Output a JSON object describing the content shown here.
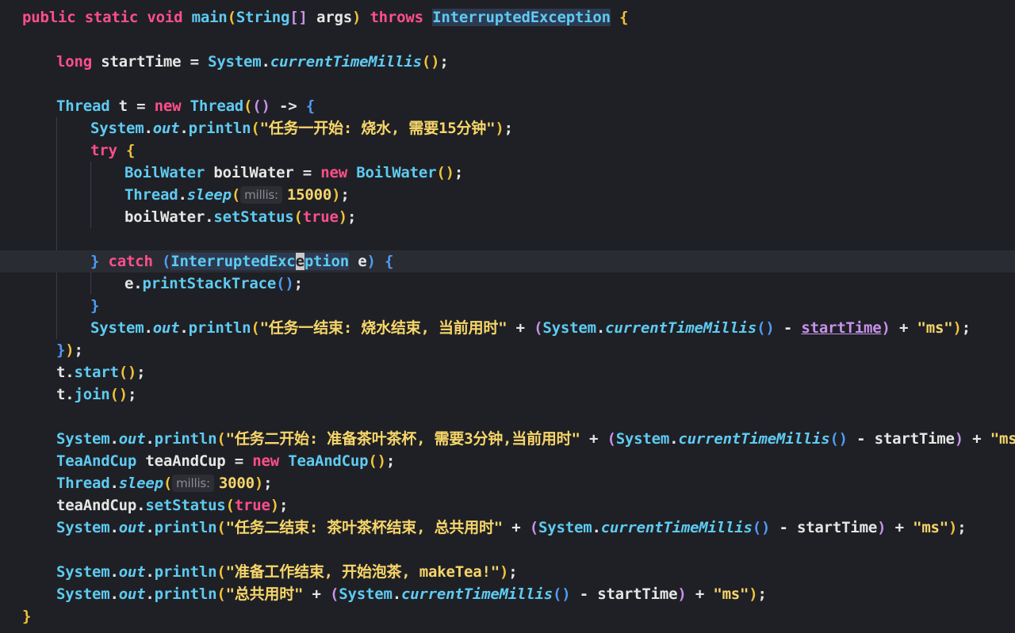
{
  "editor": {
    "language": "java",
    "current_line": 11,
    "lines": [
      {
        "indent": 0,
        "tokens": [
          {
            "t": "public",
            "c": "kw"
          },
          {
            "t": " "
          },
          {
            "t": "static",
            "c": "kw"
          },
          {
            "t": " "
          },
          {
            "t": "void",
            "c": "kw"
          },
          {
            "t": " "
          },
          {
            "t": "main",
            "c": "fn"
          },
          {
            "t": "(",
            "c": "p1"
          },
          {
            "t": "String",
            "c": "ty"
          },
          {
            "t": "[]",
            "c": "p2"
          },
          {
            "t": " args",
            "c": "id"
          },
          {
            "t": ")",
            "c": "p1"
          },
          {
            "t": " "
          },
          {
            "t": "throws",
            "c": "kw"
          },
          {
            "t": " "
          },
          {
            "t": "InterruptedException",
            "c": "hl"
          },
          {
            "t": " "
          },
          {
            "t": "{",
            "c": "br"
          }
        ]
      },
      {
        "indent": 0,
        "tokens": []
      },
      {
        "indent": 1,
        "tokens": [
          {
            "t": "long",
            "c": "kw"
          },
          {
            "t": " startTime = ",
            "c": "id"
          },
          {
            "t": "System",
            "c": "ty"
          },
          {
            "t": ".",
            "c": "op"
          },
          {
            "t": "currentTimeMillis",
            "c": "sf"
          },
          {
            "t": "()",
            "c": "p1"
          },
          {
            "t": ";",
            "c": "op"
          }
        ]
      },
      {
        "indent": 0,
        "tokens": []
      },
      {
        "indent": 1,
        "tokens": [
          {
            "t": "Thread",
            "c": "ty"
          },
          {
            "t": " t = ",
            "c": "id"
          },
          {
            "t": "new",
            "c": "kw"
          },
          {
            "t": " "
          },
          {
            "t": "Thread",
            "c": "ty"
          },
          {
            "t": "(",
            "c": "p1"
          },
          {
            "t": "()",
            "c": "p2"
          },
          {
            "t": " -> ",
            "c": "op"
          },
          {
            "t": "{",
            "c": "p3"
          }
        ]
      },
      {
        "indent": 2,
        "tokens": [
          {
            "t": "System",
            "c": "ty"
          },
          {
            "t": ".",
            "c": "op"
          },
          {
            "t": "out",
            "c": "sf"
          },
          {
            "t": ".",
            "c": "op"
          },
          {
            "t": "println",
            "c": "fn"
          },
          {
            "t": "(",
            "c": "p1"
          },
          {
            "t": "\"任务一开始: 烧水, 需要15分钟\"",
            "c": "st"
          },
          {
            "t": ")",
            "c": "p1"
          },
          {
            "t": ";",
            "c": "op"
          }
        ]
      },
      {
        "indent": 2,
        "tokens": [
          {
            "t": "try",
            "c": "kw"
          },
          {
            "t": " "
          },
          {
            "t": "{",
            "c": "p1"
          }
        ]
      },
      {
        "indent": 3,
        "tokens": [
          {
            "t": "BoilWater",
            "c": "ty"
          },
          {
            "t": " boilWater = ",
            "c": "id"
          },
          {
            "t": "new",
            "c": "kw"
          },
          {
            "t": " "
          },
          {
            "t": "BoilWater",
            "c": "ty"
          },
          {
            "t": "()",
            "c": "p1"
          },
          {
            "t": ";",
            "c": "op"
          }
        ]
      },
      {
        "indent": 3,
        "tokens": [
          {
            "t": "Thread",
            "c": "ty"
          },
          {
            "t": ".",
            "c": "op"
          },
          {
            "t": "sleep",
            "c": "sf"
          },
          {
            "t": "(",
            "c": "p1"
          },
          {
            "t": "millis:",
            "c": "hint"
          },
          {
            "t": "15000",
            "c": "nu"
          },
          {
            "t": ")",
            "c": "p1"
          },
          {
            "t": ";",
            "c": "op"
          }
        ]
      },
      {
        "indent": 3,
        "tokens": [
          {
            "t": "boilWater.",
            "c": "id"
          },
          {
            "t": "setStatus",
            "c": "fn"
          },
          {
            "t": "(",
            "c": "p1"
          },
          {
            "t": "true",
            "c": "kw"
          },
          {
            "t": ")",
            "c": "p1"
          },
          {
            "t": ";",
            "c": "op"
          }
        ]
      },
      {
        "indent": 0,
        "tokens": []
      },
      {
        "indent": 2,
        "tokens": [
          {
            "t": "}",
            "c": "p3"
          },
          {
            "t": " "
          },
          {
            "t": "catch",
            "c": "kw"
          },
          {
            "t": " "
          },
          {
            "t": "(",
            "c": "p3"
          },
          {
            "t": "InterruptedExc",
            "c": "hl"
          },
          {
            "t": "e",
            "c": "cu"
          },
          {
            "t": "ption",
            "c": "hl"
          },
          {
            "t": " e",
            "c": "id"
          },
          {
            "t": ")",
            "c": "p3"
          },
          {
            "t": " "
          },
          {
            "t": "{",
            "c": "p3"
          }
        ]
      },
      {
        "indent": 3,
        "tokens": [
          {
            "t": "e.",
            "c": "id"
          },
          {
            "t": "printStackTrace",
            "c": "fn"
          },
          {
            "t": "()",
            "c": "p3"
          },
          {
            "t": ";",
            "c": "op"
          }
        ]
      },
      {
        "indent": 2,
        "tokens": [
          {
            "t": "}",
            "c": "p3"
          }
        ]
      },
      {
        "indent": 2,
        "tokens": [
          {
            "t": "System",
            "c": "ty"
          },
          {
            "t": ".",
            "c": "op"
          },
          {
            "t": "out",
            "c": "sf"
          },
          {
            "t": ".",
            "c": "op"
          },
          {
            "t": "println",
            "c": "fn"
          },
          {
            "t": "(",
            "c": "p1"
          },
          {
            "t": "\"任务一结束: 烧水结束, 当前用时\"",
            "c": "st"
          },
          {
            "t": " + ",
            "c": "op"
          },
          {
            "t": "(",
            "c": "p2"
          },
          {
            "t": "System",
            "c": "ty"
          },
          {
            "t": ".",
            "c": "op"
          },
          {
            "t": "currentTimeMillis",
            "c": "sf"
          },
          {
            "t": "()",
            "c": "p3"
          },
          {
            "t": " - ",
            "c": "op"
          },
          {
            "t": "startTime",
            "c": "un"
          },
          {
            "t": ")",
            "c": "p2"
          },
          {
            "t": " + ",
            "c": "op"
          },
          {
            "t": "\"ms\"",
            "c": "st"
          },
          {
            "t": ")",
            "c": "p1"
          },
          {
            "t": ";",
            "c": "op"
          }
        ]
      },
      {
        "indent": 1,
        "tokens": [
          {
            "t": "}",
            "c": "p3"
          },
          {
            "t": ")",
            "c": "p1"
          },
          {
            "t": ";",
            "c": "op"
          }
        ]
      },
      {
        "indent": 1,
        "tokens": [
          {
            "t": "t.",
            "c": "id"
          },
          {
            "t": "start",
            "c": "fn"
          },
          {
            "t": "()",
            "c": "p1"
          },
          {
            "t": ";",
            "c": "op"
          }
        ]
      },
      {
        "indent": 1,
        "tokens": [
          {
            "t": "t.",
            "c": "id"
          },
          {
            "t": "join",
            "c": "fn"
          },
          {
            "t": "()",
            "c": "p1"
          },
          {
            "t": ";",
            "c": "op"
          }
        ]
      },
      {
        "indent": 0,
        "tokens": []
      },
      {
        "indent": 1,
        "tokens": [
          {
            "t": "System",
            "c": "ty"
          },
          {
            "t": ".",
            "c": "op"
          },
          {
            "t": "out",
            "c": "sf"
          },
          {
            "t": ".",
            "c": "op"
          },
          {
            "t": "println",
            "c": "fn"
          },
          {
            "t": "(",
            "c": "p1"
          },
          {
            "t": "\"任务二开始: 准备茶叶茶杯, 需要3分钟,当前用时\"",
            "c": "st"
          },
          {
            "t": " + ",
            "c": "op"
          },
          {
            "t": "(",
            "c": "p2"
          },
          {
            "t": "System",
            "c": "ty"
          },
          {
            "t": ".",
            "c": "op"
          },
          {
            "t": "currentTimeMillis",
            "c": "sf"
          },
          {
            "t": "()",
            "c": "p3"
          },
          {
            "t": " - startTime",
            "c": "id"
          },
          {
            "t": ")",
            "c": "p2"
          },
          {
            "t": " + ",
            "c": "op"
          },
          {
            "t": "\"ms\"",
            "c": "st"
          },
          {
            "t": ")",
            "c": "p1"
          },
          {
            "t": ";",
            "c": "op"
          }
        ]
      },
      {
        "indent": 1,
        "tokens": [
          {
            "t": "TeaAndCup",
            "c": "ty"
          },
          {
            "t": " teaAndCup = ",
            "c": "id"
          },
          {
            "t": "new",
            "c": "kw"
          },
          {
            "t": " "
          },
          {
            "t": "TeaAndCup",
            "c": "ty"
          },
          {
            "t": "()",
            "c": "p1"
          },
          {
            "t": ";",
            "c": "op"
          }
        ]
      },
      {
        "indent": 1,
        "tokens": [
          {
            "t": "Thread",
            "c": "ty"
          },
          {
            "t": ".",
            "c": "op"
          },
          {
            "t": "sleep",
            "c": "sf"
          },
          {
            "t": "(",
            "c": "p1"
          },
          {
            "t": "millis:",
            "c": "hint"
          },
          {
            "t": "3000",
            "c": "nu"
          },
          {
            "t": ")",
            "c": "p1"
          },
          {
            "t": ";",
            "c": "op"
          }
        ]
      },
      {
        "indent": 1,
        "tokens": [
          {
            "t": "teaAndCup.",
            "c": "id"
          },
          {
            "t": "setStatus",
            "c": "fn"
          },
          {
            "t": "(",
            "c": "p1"
          },
          {
            "t": "true",
            "c": "kw"
          },
          {
            "t": ")",
            "c": "p1"
          },
          {
            "t": ";",
            "c": "op"
          }
        ]
      },
      {
        "indent": 1,
        "tokens": [
          {
            "t": "System",
            "c": "ty"
          },
          {
            "t": ".",
            "c": "op"
          },
          {
            "t": "out",
            "c": "sf"
          },
          {
            "t": ".",
            "c": "op"
          },
          {
            "t": "println",
            "c": "fn"
          },
          {
            "t": "(",
            "c": "p1"
          },
          {
            "t": "\"任务二结束: 茶叶茶杯结束, 总共用时\"",
            "c": "st"
          },
          {
            "t": " + ",
            "c": "op"
          },
          {
            "t": "(",
            "c": "p2"
          },
          {
            "t": "System",
            "c": "ty"
          },
          {
            "t": ".",
            "c": "op"
          },
          {
            "t": "currentTimeMillis",
            "c": "sf"
          },
          {
            "t": "()",
            "c": "p3"
          },
          {
            "t": " - startTime",
            "c": "id"
          },
          {
            "t": ")",
            "c": "p2"
          },
          {
            "t": " + ",
            "c": "op"
          },
          {
            "t": "\"ms\"",
            "c": "st"
          },
          {
            "t": ")",
            "c": "p1"
          },
          {
            "t": ";",
            "c": "op"
          }
        ]
      },
      {
        "indent": 0,
        "tokens": []
      },
      {
        "indent": 1,
        "tokens": [
          {
            "t": "System",
            "c": "ty"
          },
          {
            "t": ".",
            "c": "op"
          },
          {
            "t": "out",
            "c": "sf"
          },
          {
            "t": ".",
            "c": "op"
          },
          {
            "t": "println",
            "c": "fn"
          },
          {
            "t": "(",
            "c": "p1"
          },
          {
            "t": "\"准备工作结束, 开始泡茶, makeTea!\"",
            "c": "st"
          },
          {
            "t": ")",
            "c": "p1"
          },
          {
            "t": ";",
            "c": "op"
          }
        ]
      },
      {
        "indent": 1,
        "tokens": [
          {
            "t": "System",
            "c": "ty"
          },
          {
            "t": ".",
            "c": "op"
          },
          {
            "t": "out",
            "c": "sf"
          },
          {
            "t": ".",
            "c": "op"
          },
          {
            "t": "println",
            "c": "fn"
          },
          {
            "t": "(",
            "c": "p1"
          },
          {
            "t": "\"总共用时\"",
            "c": "st"
          },
          {
            "t": " + ",
            "c": "op"
          },
          {
            "t": "(",
            "c": "p2"
          },
          {
            "t": "System",
            "c": "ty"
          },
          {
            "t": ".",
            "c": "op"
          },
          {
            "t": "currentTimeMillis",
            "c": "sf"
          },
          {
            "t": "()",
            "c": "p3"
          },
          {
            "t": " - startTime",
            "c": "id"
          },
          {
            "t": ")",
            "c": "p2"
          },
          {
            "t": " + ",
            "c": "op"
          },
          {
            "t": "\"ms\"",
            "c": "st"
          },
          {
            "t": ")",
            "c": "p1"
          },
          {
            "t": ";",
            "c": "op"
          }
        ]
      },
      {
        "indent": 0,
        "tokens": [
          {
            "t": "}",
            "c": "br"
          }
        ]
      }
    ]
  }
}
